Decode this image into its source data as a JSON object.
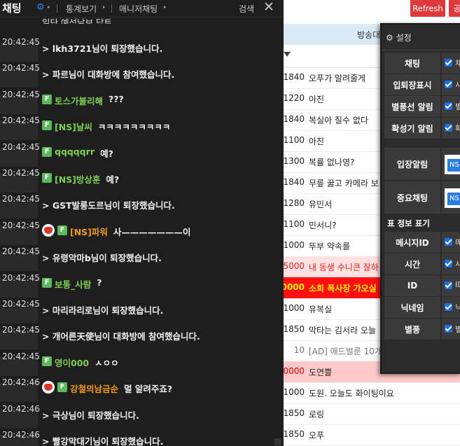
{
  "chat": {
    "title": "채팅",
    "menu_stats": "통계보기",
    "menu_manager": "매니저채팅",
    "search": "검색",
    "close": "✕",
    "partial_top": "일단 예석날보 답트",
    "messages": [
      {
        "time": "20:42:45",
        "type": "system",
        "text": "> lkh3721님이 퇴장했습니다."
      },
      {
        "time": "20:42:45",
        "type": "system",
        "text": "> 파르님이 대화방에 참여했습니다."
      },
      {
        "time": "20:42:45",
        "type": "user",
        "badge": "F",
        "nick": "토스가불리해",
        "nick_color": "green",
        "text": "???"
      },
      {
        "time": "20:42:45",
        "type": "user",
        "badge": "F",
        "nick": "[NS]날씨",
        "nick_color": "green",
        "text": "ㅋㅋㅋㅋㅋㅋㅋㅋㅋ"
      },
      {
        "time": "20:42:45",
        "type": "user",
        "badge": "F",
        "nick": "qqqqqrr",
        "nick_color": "green",
        "text": "예?"
      },
      {
        "time": "20:42:45",
        "type": "user",
        "badge": "F",
        "nick": "[NS]방상훈",
        "nick_color": "green",
        "text": "예?"
      },
      {
        "time": "20:42:45",
        "type": "system",
        "text": "> GST발롱도르님이 퇴장했습니다."
      },
      {
        "time": "20:42:45",
        "type": "user",
        "avatar": true,
        "badge": "F",
        "nick": "[NS]파워",
        "nick_color": "orange",
        "text": "사———————이"
      },
      {
        "time": "20:42:45",
        "type": "system",
        "text": "> 유령악마b님이 퇴장했습니다."
      },
      {
        "time": "20:42:45",
        "type": "user",
        "badge": "F",
        "nick": "보통_사람",
        "nick_color": "green",
        "text": "?"
      },
      {
        "time": "20:42:45",
        "type": "system",
        "text": "> 마리라리로님이 퇴장했습니다."
      },
      {
        "time": "20:42:45",
        "type": "system",
        "text": "> 개어른天使님이 대화방에 참여했습니다."
      },
      {
        "time": "20:42:45",
        "type": "user",
        "badge": "F",
        "nick": "영이000",
        "nick_color": "green",
        "text": "ㅅㅇㅇ"
      },
      {
        "time": "20:42:46",
        "type": "user",
        "avatar": true,
        "badge": "F",
        "nick": "강철의남금순",
        "nick_color": "orange",
        "text": "멀 알려주죠?"
      },
      {
        "time": "20:42:46",
        "type": "system",
        "text": "> 극상님이 퇴장했습니다."
      },
      {
        "time": "20:42:46",
        "type": "system",
        "text": "> 빨강막대기님이 퇴장했습니다."
      }
    ]
  },
  "topbar": {
    "refresh": "Refresh",
    "extra": "공"
  },
  "list": {
    "header": "방송대",
    "rows": [
      {
        "num": "1840",
        "text": "오푸가 알려줄게",
        "style": "normal"
      },
      {
        "num": "1220",
        "text": "아진",
        "style": "normal"
      },
      {
        "num": "1840",
        "text": "복실아 질수 없다",
        "style": "normal"
      },
      {
        "num": "1100",
        "text": "아진",
        "style": "normal"
      },
      {
        "num": "1300",
        "text": "복률 없나영?",
        "style": "normal"
      },
      {
        "num": "1840",
        "text": "무릎 꿇고 카메라 보",
        "style": "normal"
      },
      {
        "num": "1280",
        "text": "유민서",
        "style": "normal"
      },
      {
        "num": "1100",
        "text": "민서니?",
        "style": "normal"
      },
      {
        "num": "1000",
        "text": "뚜부 약속를",
        "style": "normal"
      },
      {
        "num": "5000",
        "text": "내 동생 수니큰 잘하",
        "style": "pink"
      },
      {
        "num": "0000",
        "text": "소희 폭사장 가오실",
        "style": "red"
      },
      {
        "num": "1000",
        "text": "유복실",
        "style": "normal"
      },
      {
        "num": "1850",
        "text": "막타는 김서라 오늘",
        "style": "normal"
      },
      {
        "num": "10",
        "text": "[AD] 애드벌룬 10개",
        "style": "ad"
      },
      {
        "num": "0000",
        "text": "도연쁠",
        "style": "pink2"
      },
      {
        "num": "1000",
        "text": "도원. 오늘도 화이팅이요",
        "style": "normal"
      },
      {
        "num": "1850",
        "text": "로링",
        "style": "normal"
      },
      {
        "num": "1850",
        "text": "오푸",
        "style": "normal"
      }
    ]
  },
  "settings": {
    "title": "설정",
    "rows": [
      {
        "label": "채팅",
        "value": "채"
      },
      {
        "label": "입퇴장표시",
        "value": "시"
      },
      {
        "label": "별풍선 알림",
        "value": "별"
      },
      {
        "label": "확성기 알림",
        "value": "확"
      }
    ],
    "entry_alert": {
      "label": "입장알림",
      "tag": "NS"
    },
    "important_chat": {
      "label": "중요채팅",
      "tag": "NS"
    },
    "section2": "표 정보 표기",
    "rows2": [
      {
        "label": "메시지ID",
        "value": "메"
      },
      {
        "label": "시간",
        "value": "시"
      },
      {
        "label": "ID",
        "value": "ID"
      },
      {
        "label": "닉네임",
        "value": "닉"
      },
      {
        "label": "별풍",
        "value": "별"
      }
    ]
  }
}
